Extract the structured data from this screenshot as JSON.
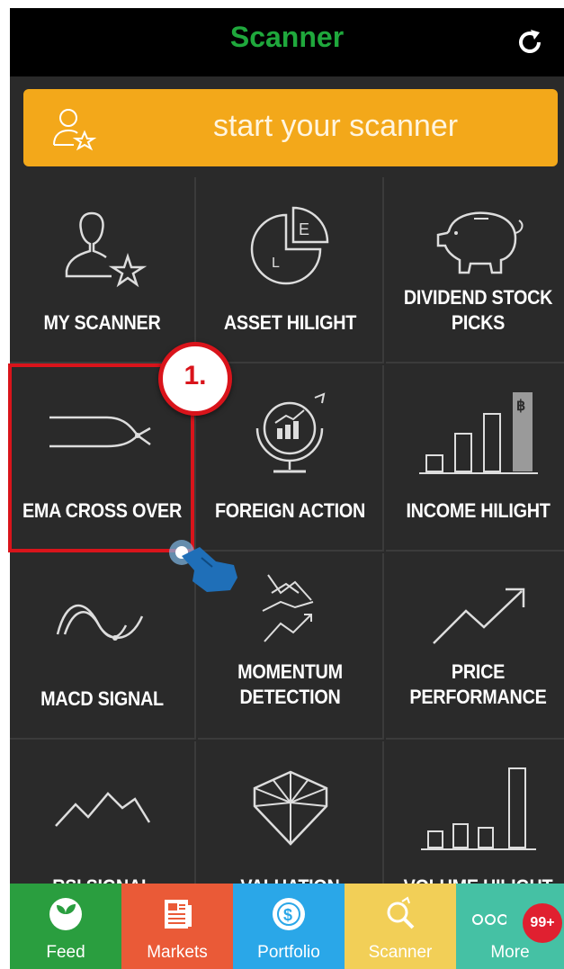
{
  "header": {
    "title": "Scanner",
    "refresh_icon": "refresh-icon"
  },
  "start": {
    "label": "start your scanner",
    "icon": "user-star-icon"
  },
  "tiles": [
    {
      "label": "MY SCANNER",
      "icon": "user-star-icon"
    },
    {
      "label": "ASSET HILIGHT",
      "icon": "pie-chart-icon"
    },
    {
      "label": "DIVIDEND STOCK PICKS",
      "icon": "piggy-bank-icon"
    },
    {
      "label": "EMA CROSS OVER",
      "icon": "cross-lines-icon"
    },
    {
      "label": "FOREIGN ACTION",
      "icon": "globe-chart-icon"
    },
    {
      "label": "INCOME HILIGHT",
      "icon": "bar-chart-icon"
    },
    {
      "label": "MACD SIGNAL",
      "icon": "wave-icon"
    },
    {
      "label": "MOMENTUM DETECTION",
      "icon": "zigzag-arrows-icon"
    },
    {
      "label": "PRICE PERFORMANCE",
      "icon": "trend-arrow-icon"
    },
    {
      "label": "RSI SIGNAL",
      "icon": "rsi-line-icon"
    },
    {
      "label": "VALUATION",
      "icon": "diamond-icon"
    },
    {
      "label": "VOLUME HILIGHT",
      "icon": "volume-bars-icon"
    }
  ],
  "annotation": {
    "step": "1."
  },
  "tabs": [
    {
      "label": "Feed",
      "color": "#2a9e3f",
      "icon": "sprout-icon"
    },
    {
      "label": "Markets",
      "color": "#ea5a37",
      "icon": "newspaper-icon"
    },
    {
      "label": "Portfolio",
      "color": "#2aa7e8",
      "icon": "coin-icon"
    },
    {
      "label": "Scanner",
      "color": "#f2cf57",
      "icon": "scanner-search-icon",
      "active": true
    },
    {
      "label": "More",
      "color": "#45c1a4",
      "icon": "more-dots-icon",
      "badge": "99+"
    }
  ],
  "colors": {
    "accent": "#1fa83c",
    "banner": "#f3a81a",
    "highlight": "#d9141b",
    "tile_bg": "#2a2a2a"
  }
}
